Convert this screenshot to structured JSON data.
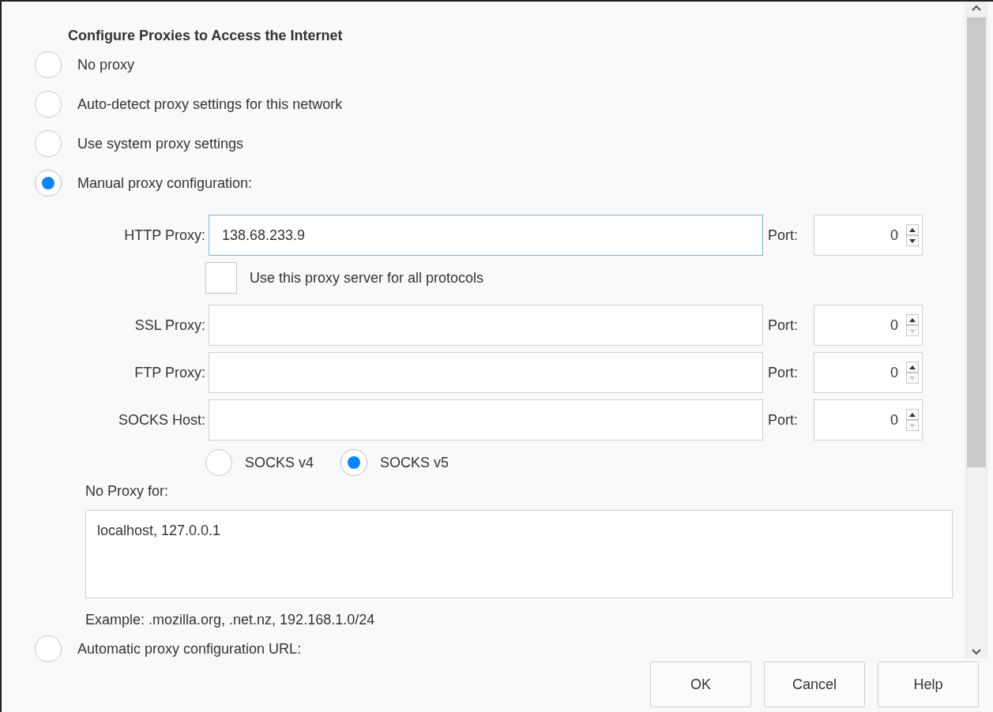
{
  "section_title": "Configure Proxies to Access the Internet",
  "proxy_modes": [
    {
      "label": "No proxy",
      "selected": false
    },
    {
      "label": "Auto-detect proxy settings for this network",
      "selected": false
    },
    {
      "label": "Use system proxy settings",
      "selected": false
    },
    {
      "label": "Manual proxy configuration:",
      "selected": true
    }
  ],
  "proxies": [
    {
      "label": "HTTP Proxy:",
      "value": "138.68.233.9",
      "focused": true,
      "port_label": "Port:",
      "port": "0",
      "down_disabled": false
    },
    {
      "label": "SSL Proxy:",
      "focused": false,
      "port_label": "Port:",
      "port": "0",
      "down_disabled": true
    },
    {
      "label": "FTP Proxy:",
      "focused": false,
      "port_label": "Port:",
      "port": "0",
      "down_disabled": true
    },
    {
      "label": "SOCKS Host:",
      "focused": false,
      "port_label": "Port:",
      "port": "0",
      "down_disabled": true
    }
  ],
  "share_all": {
    "label": "Use this proxy server for all protocols",
    "checked": false
  },
  "socks_versions": [
    {
      "label": "SOCKS v4",
      "selected": false
    },
    {
      "label": "SOCKS v5",
      "selected": true
    }
  ],
  "no_proxy": {
    "label": "No Proxy for:",
    "value": "localhost, 127.0.0.1"
  },
  "example": "Example: .mozilla.org, .net.nz, 192.168.1.0/24",
  "auto_config": {
    "label": "Automatic proxy configuration URL:",
    "selected": false
  },
  "buttons": [
    {
      "label": "OK"
    },
    {
      "label": "Cancel"
    },
    {
      "label": "Help"
    }
  ]
}
